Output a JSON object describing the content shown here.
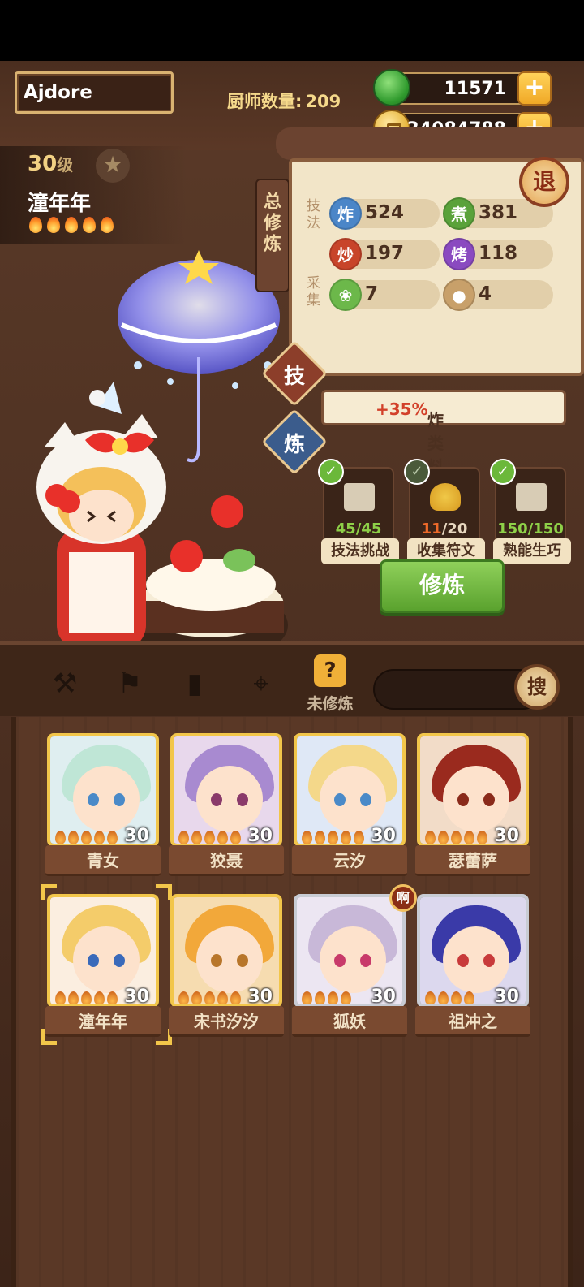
{
  "player": {
    "name": "Ajdore"
  },
  "header": {
    "chef_count_label": "厨师数量:",
    "chef_count": "209"
  },
  "currencies": {
    "jade": "11571",
    "coins": "34084788"
  },
  "selected_chef": {
    "level": "30",
    "level_unit": "级",
    "name": "潼年年"
  },
  "panel": {
    "side_title": "总修炼",
    "exit_label": "退",
    "skill_label": "技法",
    "gather_label": "采集",
    "stats": [
      {
        "badge": "炸",
        "value": "524",
        "color": "#4b86c8"
      },
      {
        "badge": "煮",
        "value": "381",
        "color": "#5aa23a"
      },
      {
        "badge": "炒",
        "value": "197",
        "color": "#c8442a"
      },
      {
        "badge": "烤",
        "value": "118",
        "color": "#8a4ac0"
      }
    ],
    "gather": [
      {
        "icon": "cabbage-icon",
        "value": "7"
      },
      {
        "icon": "bun-icon",
        "value": "4"
      }
    ],
    "bonus_prefix": "炸类料理售价",
    "bonus_value": "+35%"
  },
  "side_buttons": {
    "skill": "技",
    "refine": "炼"
  },
  "tasks": [
    {
      "done": "45",
      "total": "/45",
      "label": "技法挑战",
      "complete": true
    },
    {
      "done": "11",
      "total": "/20",
      "label": "收集符文",
      "complete": false
    },
    {
      "done": "150",
      "total": "/150",
      "label": "熟能生巧",
      "complete": true
    }
  ],
  "train_button": "修炼",
  "tabs": {
    "active_label": "未修炼",
    "search_label": "搜",
    "active_icon": "?"
  },
  "roster": [
    {
      "name": "青女",
      "level": "30",
      "hair": "#bfe6d6",
      "bg": "#dfeef0",
      "eye": "#4a8ac8"
    },
    {
      "name": "狡聂",
      "level": "30",
      "hair": "#a88ad0",
      "bg": "#e8d8ec",
      "eye": "#8a3a6a"
    },
    {
      "name": "云汐",
      "level": "30",
      "hair": "#f4d88a",
      "bg": "#dfe8f6",
      "eye": "#4a8ac8"
    },
    {
      "name": "瑟蕾萨",
      "level": "30",
      "hair": "#9a2a1e",
      "bg": "#f2dcc8",
      "eye": "#8a2a1a"
    },
    {
      "name": "潼年年",
      "level": "30",
      "hair": "#f4cc6a",
      "bg": "#fbeee0",
      "eye": "#3a6aba"
    },
    {
      "name": "宋书汐汐",
      "level": "30",
      "hair": "#f2a83a",
      "bg": "#f6dcb0",
      "eye": "#b8762a"
    },
    {
      "name": "狐妖",
      "level": "30",
      "hair": "#c8b8d8",
      "bg": "#ece6f2",
      "eye": "#c83a6a"
    },
    {
      "name": "祖冲之",
      "level": "30",
      "hair": "#3a3aa8",
      "bg": "#dcd8ee",
      "eye": "#c83a3a"
    }
  ],
  "roster_badge": "啊"
}
